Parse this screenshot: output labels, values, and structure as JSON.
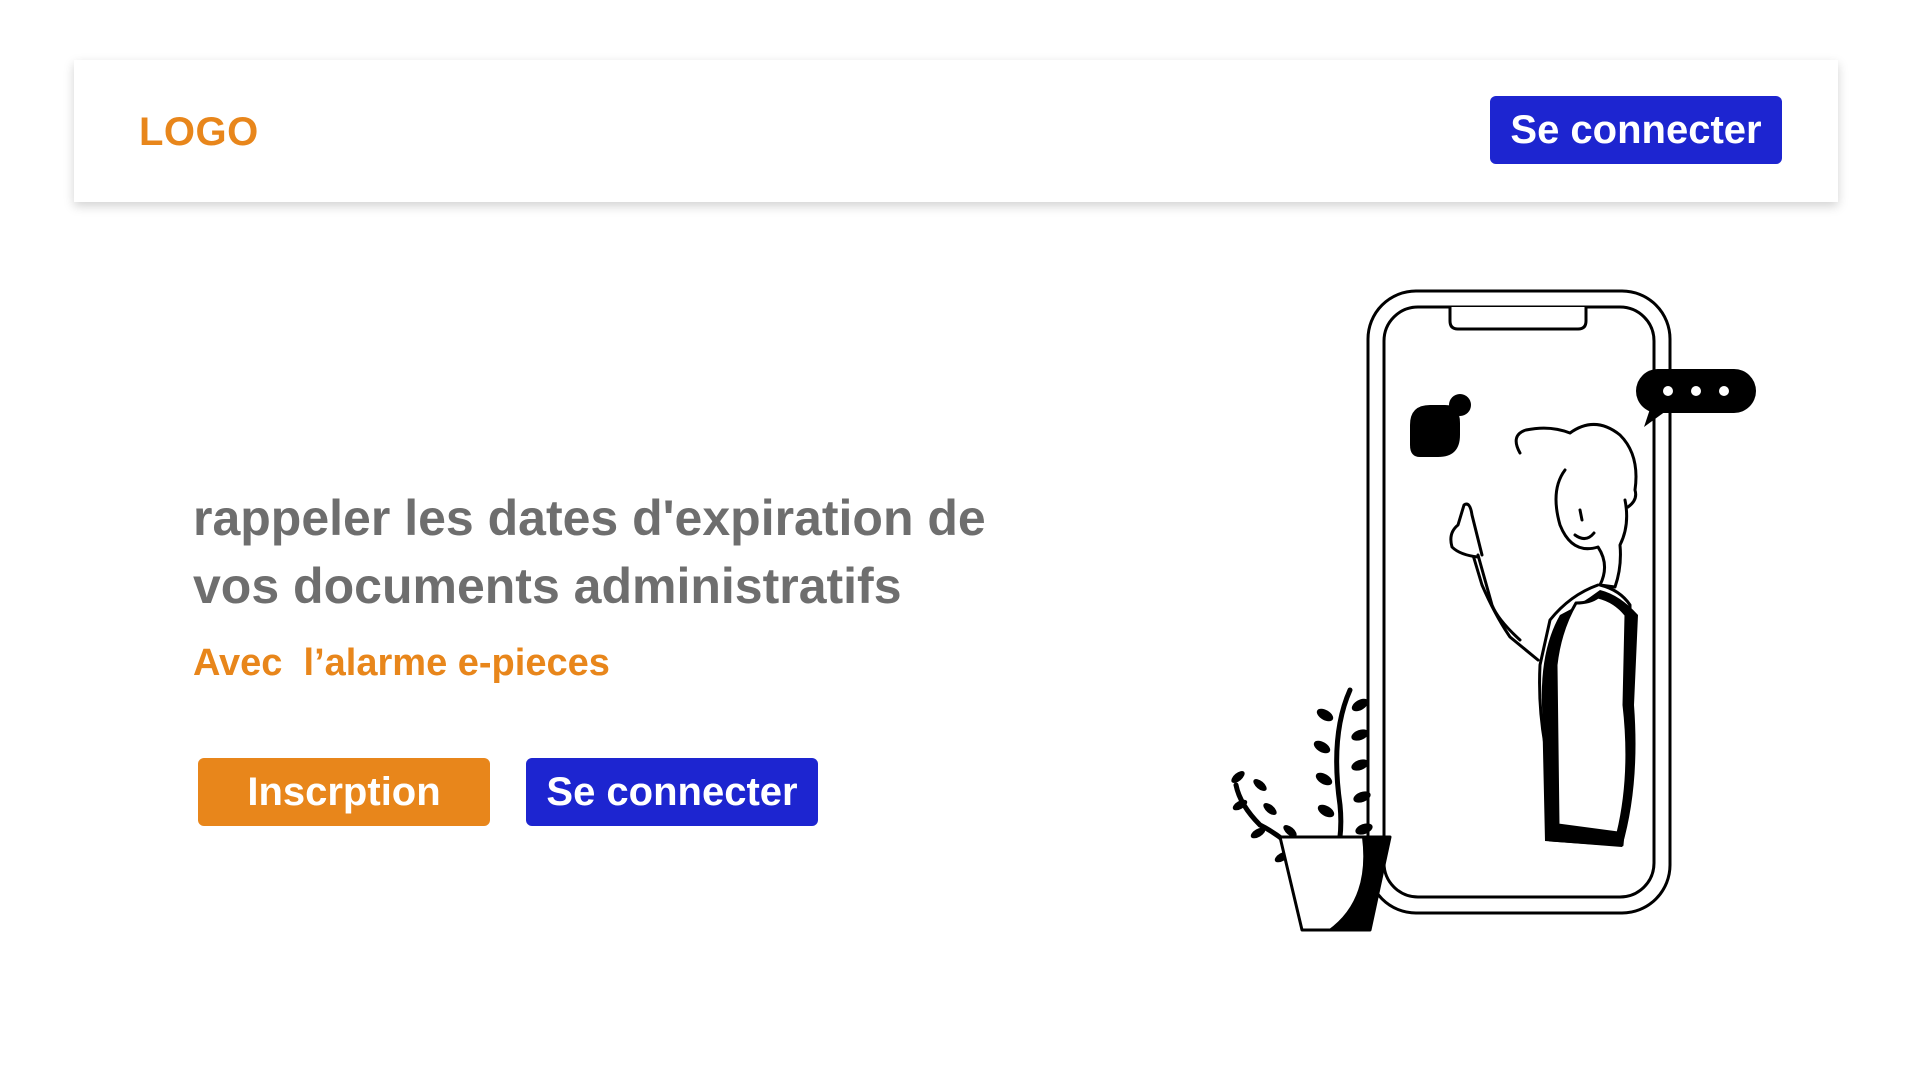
{
  "header": {
    "logo": "LOGO",
    "login_label": "Se connecter"
  },
  "hero": {
    "headline_line1": "rappeler les dates d'expiration de",
    "headline_line2": "vos documents administratifs",
    "subline": "Avec  l’alarme e-pieces",
    "signup_label": "Inscrption",
    "login_label": "Se connecter"
  },
  "colors": {
    "accent_orange": "#e8861b",
    "primary_blue": "#1d25d0",
    "text_gray": "#6e6e6e"
  }
}
